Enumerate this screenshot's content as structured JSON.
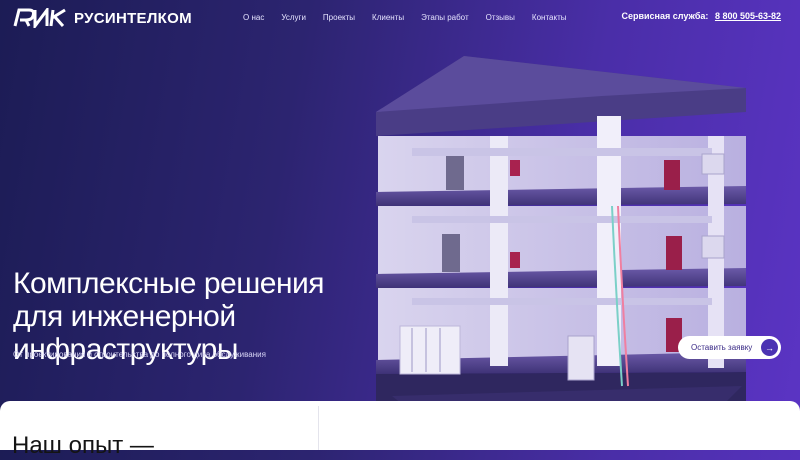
{
  "brand": {
    "logo_mark": "РИК",
    "name": "РУСИНТЕЛКОМ"
  },
  "nav": [
    {
      "label": "О нас"
    },
    {
      "label": "Услуги"
    },
    {
      "label": "Проекты"
    },
    {
      "label": "Клиенты"
    },
    {
      "label": "Этапы работ"
    },
    {
      "label": "Отзывы"
    },
    {
      "label": "Контакты"
    }
  ],
  "service": {
    "label": "Сервисная служба:",
    "phone": "8 800 505-63-82"
  },
  "hero": {
    "title_lines": [
      "Комплексные решения",
      "для инженерной",
      "инфраструктуры"
    ],
    "subtitle": "От проектирования и строительства до полного цика обслуживания",
    "cta_label": "Оставить заявку",
    "image_icon": "building-cutaway-illustration"
  },
  "section": {
    "title": "Наш опыт —"
  },
  "colors": {
    "bg_start": "#1c1c55",
    "bg_end": "#5b34c4",
    "accent": "#4b33b3",
    "text": "#ffffff"
  }
}
